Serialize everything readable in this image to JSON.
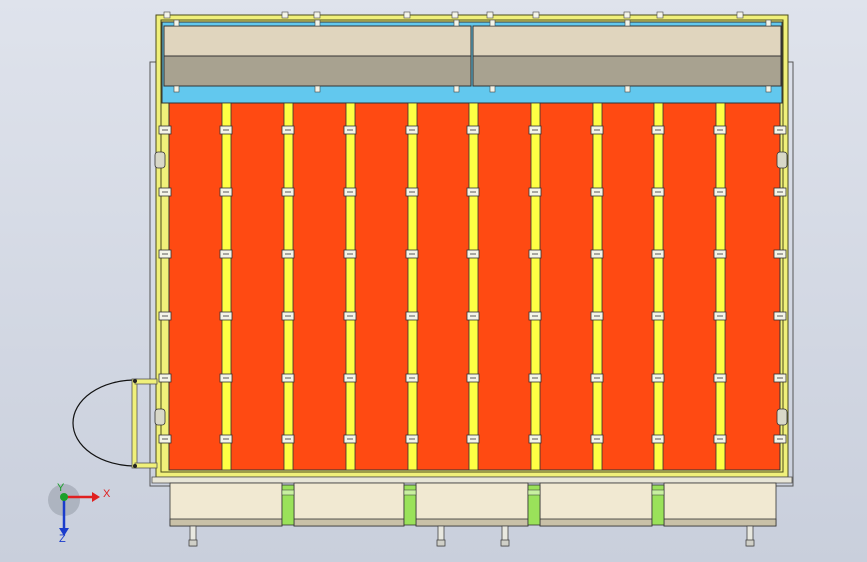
{
  "colors": {
    "background_top": "#dfe3ec",
    "background_bottom": "#c9cfdc",
    "frame": "#f0f07a",
    "frame_edge": "#4a4a1a",
    "header_band": "#62c8ee",
    "panel_light": "#e0d5be",
    "panel_dark": "#a8a290",
    "module": "#ff4a12",
    "strip": "#ffff44",
    "bottom_box": "#f1e9d2",
    "bottom_box_dark": "#c9c1a8",
    "connector": "#9ae25a",
    "axis_x": "#e02020",
    "axis_y": "#1a3ccc",
    "axis_z": "#1a3ccc",
    "axis_origin": "#1aa02a"
  },
  "layout_counts": {
    "module_columns": 10,
    "clip_rows": 6,
    "bottom_boxes": 5,
    "top_panels": 2
  },
  "axes": {
    "x_label": "X",
    "z_label": "Z",
    "y_label": "Y"
  }
}
